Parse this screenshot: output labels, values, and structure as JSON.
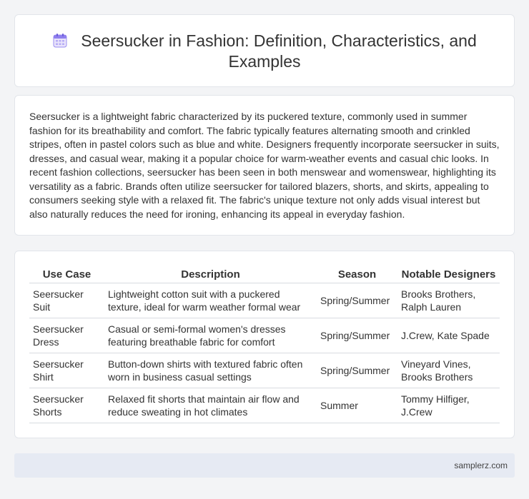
{
  "header": {
    "title": "Seersucker in Fashion: Definition, Characteristics, and Examples",
    "icon": "calendar-icon"
  },
  "intro": {
    "text": "Seersucker is a lightweight fabric characterized by its puckered texture, commonly used in summer fashion for its breathability and comfort. The fabric typically features alternating smooth and crinkled stripes, often in pastel colors such as blue and white. Designers frequently incorporate seersucker in suits, dresses, and casual wear, making it a popular choice for warm-weather events and casual chic looks. In recent fashion collections, seersucker has been seen in both menswear and womenswear, highlighting its versatility as a fabric. Brands often utilize seersucker for tailored blazers, shorts, and skirts, appealing to consumers seeking style with a relaxed fit. The fabric's unique texture not only adds visual interest but also naturally reduces the need for ironing, enhancing its appeal in everyday fashion."
  },
  "table": {
    "headers": [
      "Use Case",
      "Description",
      "Season",
      "Notable Designers"
    ],
    "rows": [
      [
        "Seersucker Suit",
        "Lightweight cotton suit with a puckered texture, ideal for warm weather formal wear",
        "Spring/Summer",
        "Brooks Brothers, Ralph Lauren"
      ],
      [
        "Seersucker Dress",
        "Casual or semi-formal women's dresses featuring breathable fabric for comfort",
        "Spring/Summer",
        "J.Crew, Kate Spade"
      ],
      [
        "Seersucker Shirt",
        "Button-down shirts with textured fabric often worn in business casual settings",
        "Spring/Summer",
        "Vineyard Vines, Brooks Brothers"
      ],
      [
        "Seersucker Shorts",
        "Relaxed fit shorts that maintain air flow and reduce sweating in hot climates",
        "Summer",
        "Tommy Hilfiger, J.Crew"
      ]
    ]
  },
  "footer": {
    "site": "samplerz.com"
  },
  "colors": {
    "background": "#f3f4f6",
    "card": "#ffffff",
    "footer": "#e6eaf3",
    "icon_accent": "#7b6be6"
  }
}
